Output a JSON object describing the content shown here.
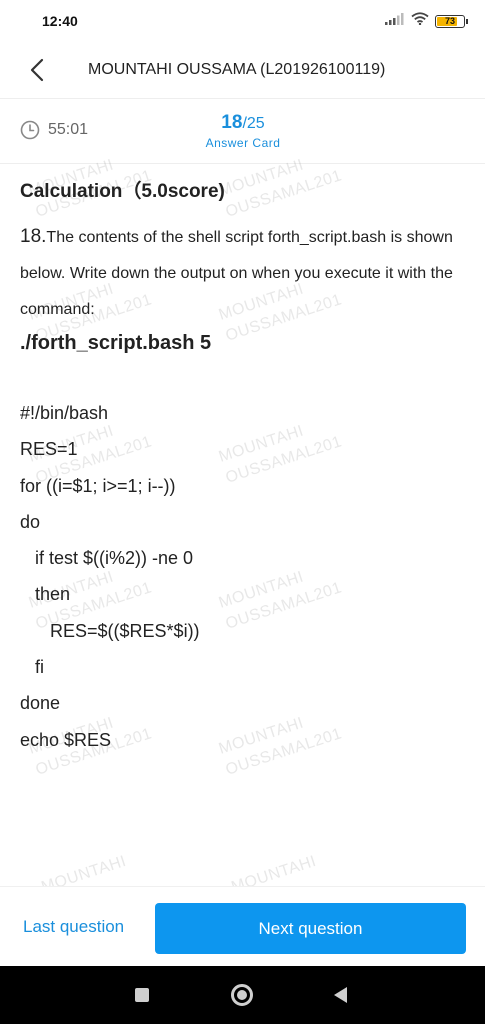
{
  "status": {
    "time": "12:40",
    "battery": "73",
    "battery_level": 0.73
  },
  "header": {
    "title": "MOUNTAHI OUSSAMA (L201926100119)"
  },
  "timer": {
    "value": "55:01"
  },
  "progress": {
    "current": "18",
    "total": "/25",
    "answer_card": "Answer Card"
  },
  "section": {
    "title": "Calculation（5.0score)"
  },
  "question": {
    "number": "18.",
    "text": "The contents of the shell script forth_script.bash is shown below. Write down the output on when you execute it with the command:",
    "command": "./forth_script.bash 5"
  },
  "code": [
    "#!/bin/bash",
    "RES=1",
    "for ((i=$1; i>=1; i--))",
    "do",
    "   if test $((i%2)) -ne 0",
    "   then",
    "      RES=$(($RES*$i))",
    "   fi",
    "done",
    "echo $RES"
  ],
  "watermark": {
    "line1": "MOUNTAHI",
    "line2": "OUSSAMAL201"
  },
  "footer": {
    "last": "Last question",
    "next": "Next question"
  },
  "colors": {
    "accent": "#1a8fdc",
    "button": "#0d96ef",
    "battery": "#f5b400"
  }
}
